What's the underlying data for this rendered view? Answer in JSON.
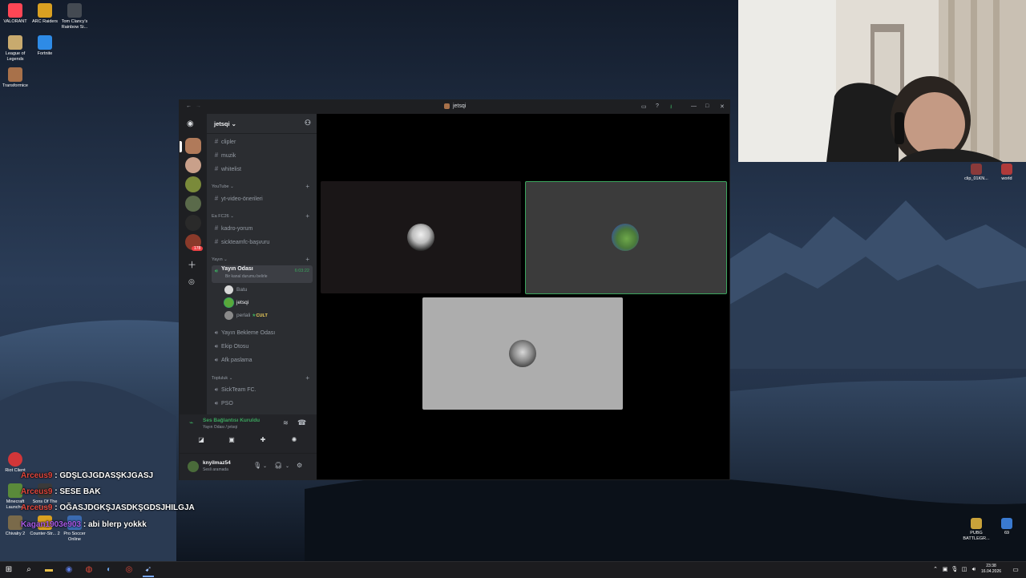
{
  "desktop": {
    "icons_left": [
      {
        "label": "VALORANT",
        "color": "#ff4655"
      },
      {
        "label": "ARC Raiders",
        "color": "#d9a021"
      },
      {
        "label": "Tom Clancy's Rainbow Si...",
        "color": "#444a52"
      },
      {
        "label": "League of Legends",
        "color": "#c8aa6e"
      },
      {
        "label": "Fortnite",
        "color": "#2e8be6"
      },
      {
        "label": "Transformice",
        "color": "#a8714a"
      }
    ],
    "icons_bottom": [
      {
        "label": "Riot Client",
        "color": "#d13639"
      },
      {
        "label": "Minecraft Launcher",
        "color": "#5a8a3a"
      },
      {
        "label": "Sons Of The Forest",
        "color": "#3a3a3a"
      },
      {
        "label": "Chivalry 2",
        "color": "#7a6a4a"
      },
      {
        "label": "Counter-Str... 2",
        "color": "#d9a021"
      },
      {
        "label": "Pro Soccer Online",
        "color": "#3a6ab0"
      }
    ],
    "icons_right": [
      {
        "label": "clip_01KN...",
        "color": "#8a3a3a"
      },
      {
        "label": "world",
        "color": "#b03a3a"
      },
      {
        "label": "PUBG BATTLEGR...",
        "color": "#c9a23a"
      },
      {
        "label": "69",
        "color": "#3a7ad0"
      }
    ]
  },
  "discord": {
    "window_title": "jetsqi",
    "server_name": "jetsqi",
    "channels_top": [
      {
        "name": "clipler",
        "type": "text"
      },
      {
        "name": "muzik",
        "type": "text"
      },
      {
        "name": "whitelist",
        "type": "text"
      }
    ],
    "category_youtube": "YouTube",
    "channels_youtube": [
      {
        "name": "yt-video-önerileri",
        "type": "text"
      }
    ],
    "category_fc": "Ea FC26",
    "channels_fc": [
      {
        "name": "kadro-yorum",
        "type": "text"
      },
      {
        "name": "sickteamfc-başvuru",
        "type": "text"
      }
    ],
    "category_yayin": "Yayın",
    "active_channel": {
      "name": "Yayın Odası",
      "status": "Bir kanal durumu belirle",
      "timer": "6:03:22"
    },
    "voice_users": [
      {
        "name": "Batu",
        "avatar_color": "#d8d8d8"
      },
      {
        "name": "jetsqi",
        "avatar_color": "#5aa83a",
        "tag": ""
      },
      {
        "name": "perlali",
        "avatar_color": "#8a8a8a",
        "tag": "CULT"
      }
    ],
    "channels_voice": [
      {
        "name": "Yayın Bekleme Odası"
      },
      {
        "name": "Ekip Otosu"
      },
      {
        "name": "Afk paslama"
      }
    ],
    "category_topluluk": "Topluluk",
    "channels_topluluk": [
      {
        "name": "SickTeam FC."
      },
      {
        "name": "PSO"
      }
    ],
    "voice_panel": {
      "status": "Ses Bağlantısı Kuruldu",
      "sub": "Yayın Odası / jetsqi"
    },
    "user_panel": {
      "username": "knyilmaz54",
      "status": "Sesli aramada"
    },
    "badge": "178",
    "accent_green": "#3ba55d"
  },
  "chat": [
    {
      "user": "Arceus9",
      "msg": "GDŞLGJGDASŞKJGASJ",
      "color": "#e0463c"
    },
    {
      "user": "Arceus9",
      "msg": "SESE BAK",
      "color": "#e0463c"
    },
    {
      "user": "Arceus9",
      "msg": "OĞASJDGKŞJASDKŞGDSJHILGJA",
      "color": "#e0463c"
    },
    {
      "user": "Kagan1903e903",
      "msg": "abi blerp yokkk",
      "color": "#a85ae6"
    }
  ],
  "taskbar": {
    "time": "23:38",
    "date": "16.04.2026"
  }
}
